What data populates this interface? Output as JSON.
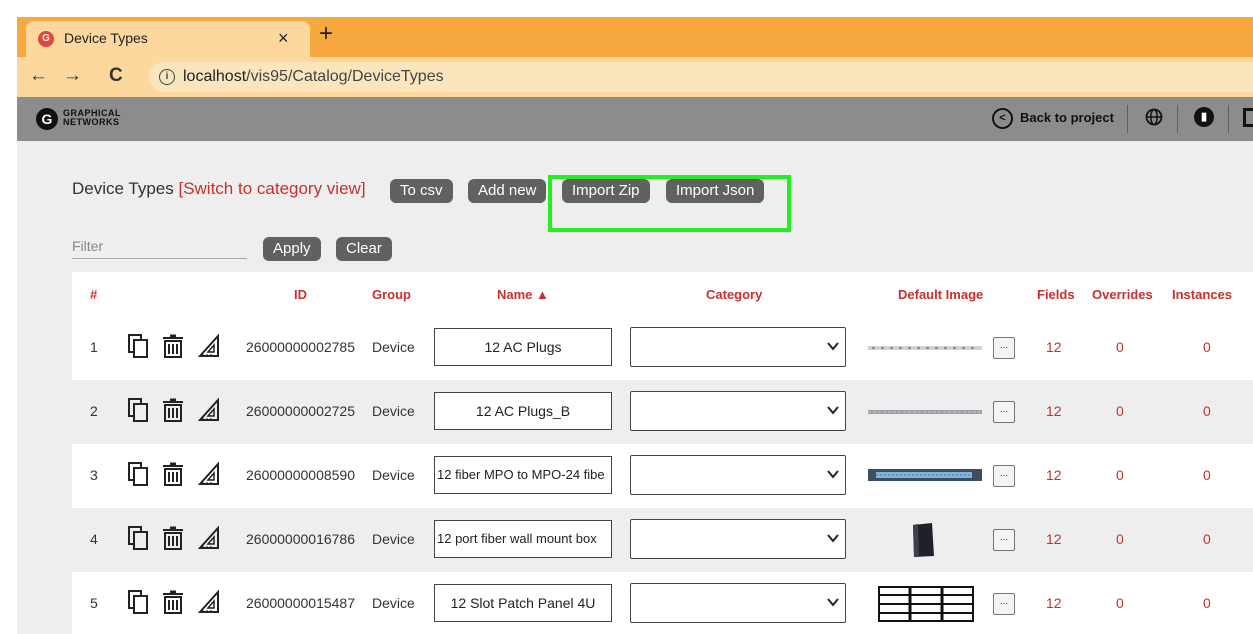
{
  "browser": {
    "tab_title": "Device Types",
    "tab_close": "×",
    "new_tab": "+",
    "back": "←",
    "forward": "→",
    "reload": "C",
    "url_host": "localhost",
    "url_path": "/vis95/Catalog/DeviceTypes"
  },
  "app_header": {
    "logo_glyph": "G",
    "logo_line1": "GRAPHICAL",
    "logo_line2": "NETWORKS",
    "back_to_project": "Back to project",
    "icons": [
      "back-circle-icon",
      "globe-icon",
      "chart-icon"
    ]
  },
  "toolbar": {
    "title": "Device Types ",
    "switch_link": "[Switch to category view]",
    "to_csv": "To csv",
    "add_new": "Add new",
    "import_zip": "Import Zip",
    "import_json": "Import Json",
    "filter_placeholder": "Filter",
    "apply": "Apply",
    "clear": "Clear"
  },
  "colors": {
    "accent_red": "#c8302f",
    "highlight_green": "#22ee22",
    "button_gray": "#616161",
    "tab_orange": "#f7a940"
  },
  "table": {
    "headers": {
      "num": "#",
      "id": "ID",
      "group": "Group",
      "name": "Name ▲",
      "category": "Category",
      "default_image": "Default Image",
      "fields": "Fields",
      "overrides": "Overrides",
      "instances": "Instances"
    },
    "rows": [
      {
        "num": "1",
        "id": "26000000002785",
        "group": "Device",
        "name": "12 AC Plugs",
        "category": "",
        "fields": "12",
        "overrides": "0",
        "instances": "0",
        "image": "power-strip-image",
        "dots": "..."
      },
      {
        "num": "2",
        "id": "26000000002725",
        "group": "Device",
        "name": "12 AC Plugs_B",
        "category": "",
        "fields": "12",
        "overrides": "0",
        "instances": "0",
        "image": "power-strip-b-image",
        "dots": "..."
      },
      {
        "num": "3",
        "id": "26000000008590",
        "group": "Device",
        "name": "12 fiber MPO to MPO-24 fibe",
        "category": "",
        "fields": "12",
        "overrides": "0",
        "instances": "0",
        "image": "fiber-panel-image",
        "dots": "..."
      },
      {
        "num": "4",
        "id": "26000000016786",
        "group": "Device",
        "name": "12 port fiber wall mount box",
        "category": "",
        "fields": "12",
        "overrides": "0",
        "instances": "0",
        "image": "wall-box-image",
        "dots": "..."
      },
      {
        "num": "5",
        "id": "26000000015487",
        "group": "Device",
        "name": "12 Slot Patch Panel 4U",
        "category": "",
        "fields": "12",
        "overrides": "0",
        "instances": "0",
        "image": "patch-panel-image",
        "dots": "..."
      }
    ]
  }
}
